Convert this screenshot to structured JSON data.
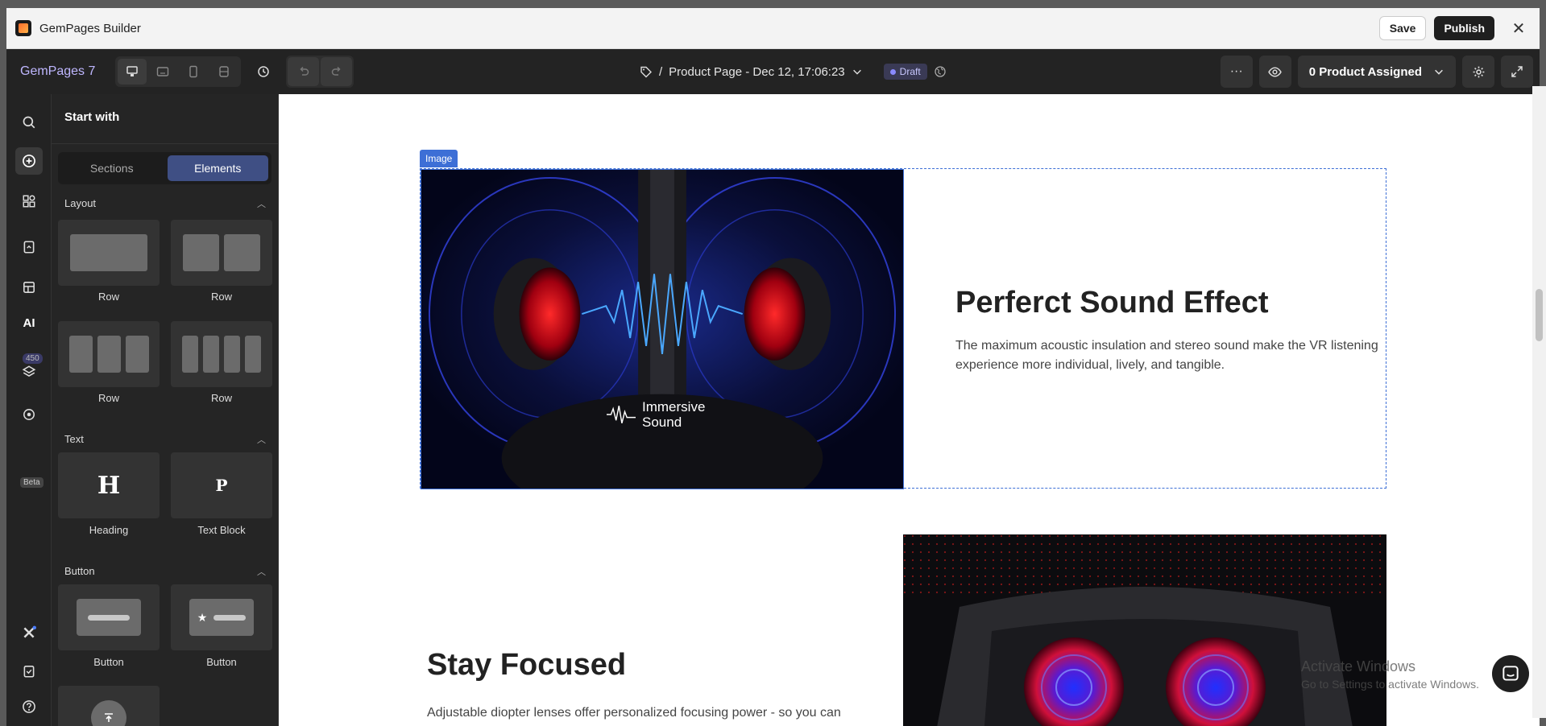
{
  "window": {
    "title": "GemPages Builder",
    "save_label": "Save",
    "publish_label": "Publish",
    "close_glyph": "✕"
  },
  "toolbar": {
    "brand": "GemPages 7",
    "page_prefix": "/",
    "page_name": "Product Page - Dec 12, 17:06:23",
    "status": "Draft",
    "more_glyph": "···",
    "assigned_label": "0 Product Assigned"
  },
  "rail": {
    "badge_count": "450",
    "ai_label": "AI",
    "beta_label": "Beta"
  },
  "panel": {
    "title": "Start with",
    "tabs": [
      "Sections",
      "Elements"
    ],
    "active_tab": "Elements",
    "sections": {
      "layout": "Layout",
      "text": "Text",
      "button": "Button"
    },
    "layout_items": [
      "Row",
      "Row",
      "Row",
      "Row"
    ],
    "text_items": [
      "Heading",
      "Text Block"
    ],
    "text_glyphs": [
      "H",
      "P"
    ],
    "button_items": [
      "Button",
      "Button"
    ]
  },
  "canvas": {
    "selected_tag": "Image",
    "section1": {
      "image_caption_line1": "Immersive",
      "image_caption_line2": "Sound",
      "heading": "Perferct Sound Effect",
      "text": "The maximum acoustic insulation and stereo sound make the VR listening experience more individual, lively, and tangible."
    },
    "section2": {
      "heading": "Stay Focused",
      "text": "Adjustable diopter lenses offer personalized focusing power - so you can find your viewing sweet spot."
    }
  },
  "watermark": {
    "line1": "Activate Windows",
    "line2": "Go to Settings to activate Windows."
  },
  "colors": {
    "accent": "#3d6fd6",
    "toolbar_bg": "#232323",
    "brand": "#bfb7ff",
    "active_tab": "#3f4f84"
  }
}
